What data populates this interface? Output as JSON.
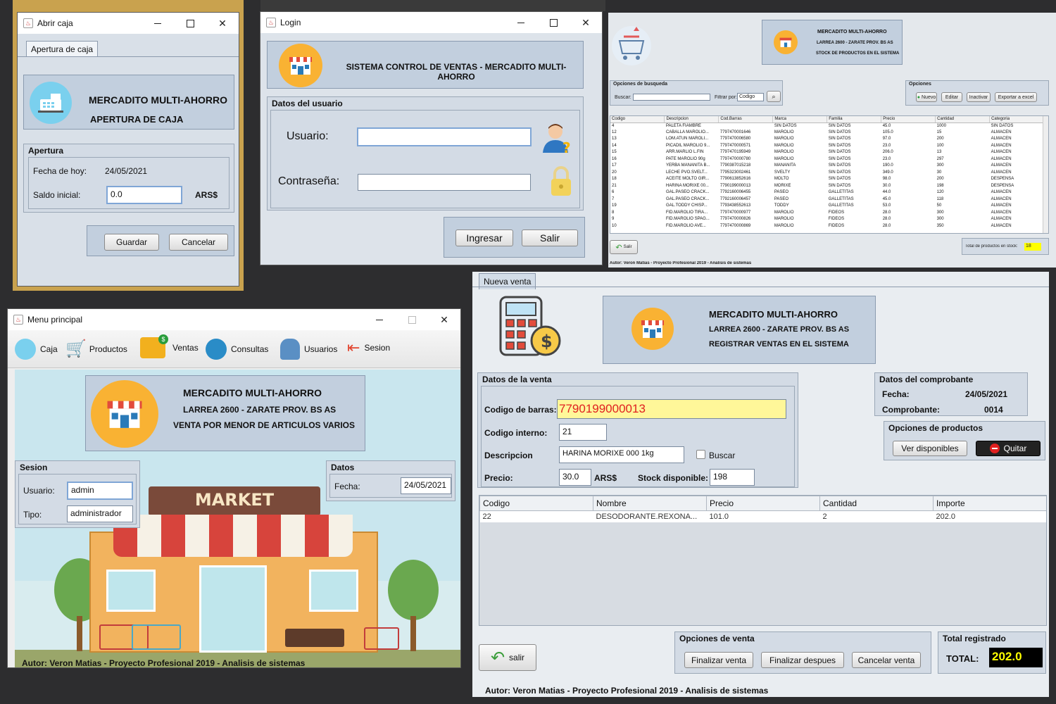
{
  "abrir_caja": {
    "title": "Abrir caja",
    "tab": "Apertura de caja",
    "header_line1": "MERCADITO MULTI-AHORRO",
    "header_line2": "APERTURA DE CAJA",
    "group_title": "Apertura",
    "fecha_label": "Fecha de hoy:",
    "fecha_value": "24/05/2021",
    "saldo_label": "Saldo inicial:",
    "saldo_value": "0.0",
    "currency": "ARS$",
    "guardar": "Guardar",
    "cancelar": "Cancelar"
  },
  "login": {
    "title": "Login",
    "header": "SISTEMA CONTROL DE VENTAS - MERCADITO MULTI-AHORRO",
    "group_title": "Datos del usuario",
    "usuario_label": "Usuario:",
    "usuario_value": "",
    "contrasena_label": "Contraseña:",
    "contrasena_value": "",
    "ingresar": "Ingresar",
    "salir": "Salir"
  },
  "stock": {
    "header_line1": "MERCADITO MULTI-AHORRO",
    "header_line2": "LARREA 2600 - ZARATE PROV. BS AS",
    "header_line3": "STOCK DE PRODUCTOS EN EL SISTEMA",
    "search_group": "Opciones de busqueda",
    "buscar_label": "Buscar:",
    "filtrar_label": "Filtrar por:",
    "filtrar_value": "Codigo",
    "opciones_group": "Opciones",
    "btn_nuevo": "Nuevo",
    "btn_editar": "Editar",
    "btn_inactivar": "Inactivar",
    "btn_exportar": "Exportar a excel",
    "columns": [
      "Codigo",
      "Descripcion",
      "Cod.Barras",
      "Marca",
      "Familia",
      "Precio",
      "Cantidad",
      "Categoria"
    ],
    "rows": [
      [
        "4",
        "PALETA FIAMBRE",
        "",
        "SIN DATOS",
        "SIN DATOS",
        "45.0",
        "1000",
        "SIN DATOS"
      ],
      [
        "12",
        "CABALLA MAROLIO...",
        "7797470001646",
        "MAROLIO",
        "SIN DATOS",
        "105.0",
        "15",
        "ALMACEN"
      ],
      [
        "13",
        "LOM.ATUN MAROLI...",
        "7797470006580",
        "MAROLIO",
        "SIN DATOS",
        "97.0",
        "200",
        "ALMACEN"
      ],
      [
        "14",
        "PICADIL MAROLIO 9...",
        "7797470000571",
        "MAROLIO",
        "SIN DATOS",
        "23.0",
        "100",
        "ALMACEN"
      ],
      [
        "15",
        "ARR.MARLIO L.FIN",
        "7797470195949",
        "MAROLIO",
        "SIN DATOS",
        "206.0",
        "13",
        "ALMACEN"
      ],
      [
        "16",
        "PATE MAROLIO 90g",
        "7797470000780",
        "MAROLIO",
        "SIN DATOS",
        "23.0",
        "297",
        "ALMACEN"
      ],
      [
        "17",
        "YERBA MAÑANITA B...",
        "7790387015218",
        "MAÑANITA",
        "SIN DATOS",
        "190.0",
        "300",
        "ALMACEN"
      ],
      [
        "20",
        "LECHE PVO.SVELT...",
        "7795323002461",
        "SVELTY",
        "SIN DATOS",
        "349.0",
        "30",
        "ALMACEN"
      ],
      [
        "18",
        "ACEITE MOLTO GIR...",
        "7790613852616",
        "MOLTO",
        "SIN DATOS",
        "98.0",
        "200",
        "DESPENSA"
      ],
      [
        "21",
        "HARINA MORIXE 00...",
        "7790199000013",
        "MORIXE",
        "SIN DATOS",
        "30.0",
        "198",
        "DESPENSA"
      ],
      [
        "6",
        "GAL.PASEO CRACK...",
        "7792160006455",
        "PASEO",
        "GALLETITAS",
        "44.0",
        "120",
        "ALMACEN"
      ],
      [
        "7",
        "GAL.PASEO CRACK...",
        "7792160006457",
        "PASEO",
        "GALLETITAS",
        "45.0",
        "118",
        "ALMACEN"
      ],
      [
        "19",
        "GAL.TODDY CHISP...",
        "7793438552613",
        "TODDY",
        "GALLETITAS",
        "53.0",
        "50",
        "ALMACEN"
      ],
      [
        "8",
        "FID.MAROLIO TIRA...",
        "7797470000977",
        "MAROLIO",
        "FIDEOS",
        "28.0",
        "300",
        "ALMACEN"
      ],
      [
        "9",
        "FID.MAROLIO SPAG...",
        "7797470000826",
        "MAROLIO",
        "FIDEOS",
        "28.0",
        "300",
        "ALMACEN"
      ],
      [
        "10",
        "FID.MAROLIO AVE...",
        "7797470000869",
        "MAROLIO",
        "FIDEOS",
        "28.0",
        "350",
        "ALMACEN"
      ]
    ],
    "salir": "Salir",
    "total_label": "Total de productos en stock:",
    "total_value": "18",
    "footer": "Autor: Veron Matias - Proyecto Profesional 2019 - Analisis de sistemas"
  },
  "menu": {
    "title": "Menu principal",
    "items": [
      {
        "label": "Caja"
      },
      {
        "label": "Productos"
      },
      {
        "label": "Ventas"
      },
      {
        "label": "Consultas"
      },
      {
        "label": "Usuarios"
      },
      {
        "label": "Sesion"
      }
    ],
    "header_line1": "MERCADITO MULTI-AHORRO",
    "header_line2": "LARREA 2600 - ZARATE PROV. BS AS",
    "header_line3": "VENTA POR MENOR DE ARTICULOS VARIOS",
    "sesion_group": "Sesion",
    "usuario_label": "Usuario:",
    "usuario_value": "admin",
    "tipo_label": "Tipo:",
    "tipo_value": "administrador",
    "datos_group": "Datos",
    "fecha_label": "Fecha:",
    "fecha_value": "24/05/2021",
    "market_sign": "MARKET",
    "footer": "Autor: Veron Matias - Proyecto Profesional 2019 - Analisis de sistemas"
  },
  "venta": {
    "tab": "Nueva venta",
    "header_line1": "MERCADITO MULTI-AHORRO",
    "header_line2": "LARREA 2600 - ZARATE PROV. BS AS",
    "header_line3": "REGISTRAR VENTAS EN EL SISTEMA",
    "datos_group": "Datos de la venta",
    "barras_label": "Codigo de barras:",
    "barras_value": "7790199000013",
    "interno_label": "Codigo interno:",
    "interno_value": "21",
    "desc_label": "Descripcion",
    "desc_value": "HARINA MORIXE 000 1kg",
    "buscar_label": "Buscar",
    "precio_label": "Precio:",
    "precio_value": "30.0",
    "currency": "ARS$",
    "stock_label": "Stock disponible:",
    "stock_value": "198",
    "comp_group": "Datos del comprobante",
    "fecha_label": "Fecha:",
    "fecha_value": "24/05/2021",
    "comp_label": "Comprobante:",
    "comp_value": "0014",
    "opc_prod_group": "Opciones de productos",
    "ver_disponibles": "Ver disponibles",
    "quitar": "Quitar",
    "columns": [
      "Codigo",
      "Nombre",
      "Precio",
      "Cantidad",
      "Importe"
    ],
    "rows": [
      [
        "22",
        "DESODORANTE.REXONA...",
        "101.0",
        "2",
        "202.0"
      ]
    ],
    "salir": "salir",
    "opc_venta_group": "Opciones de venta",
    "finalizar": "Finalizar venta",
    "finalizar_despues": "Finalizar despues",
    "cancelar": "Cancelar venta",
    "total_group": "Total registrado",
    "total_label": "TOTAL:",
    "total_value": "202.0",
    "footer": "Autor: Veron Matias - Proyecto Profesional 2019 - Analisis de sistemas"
  },
  "colors": {
    "accent_yellow": "#f9b233",
    "panel_blue": "#c2cfde",
    "highlight_field": "#fff799",
    "total_bg": "#000000",
    "total_fg": "#ffff00"
  }
}
